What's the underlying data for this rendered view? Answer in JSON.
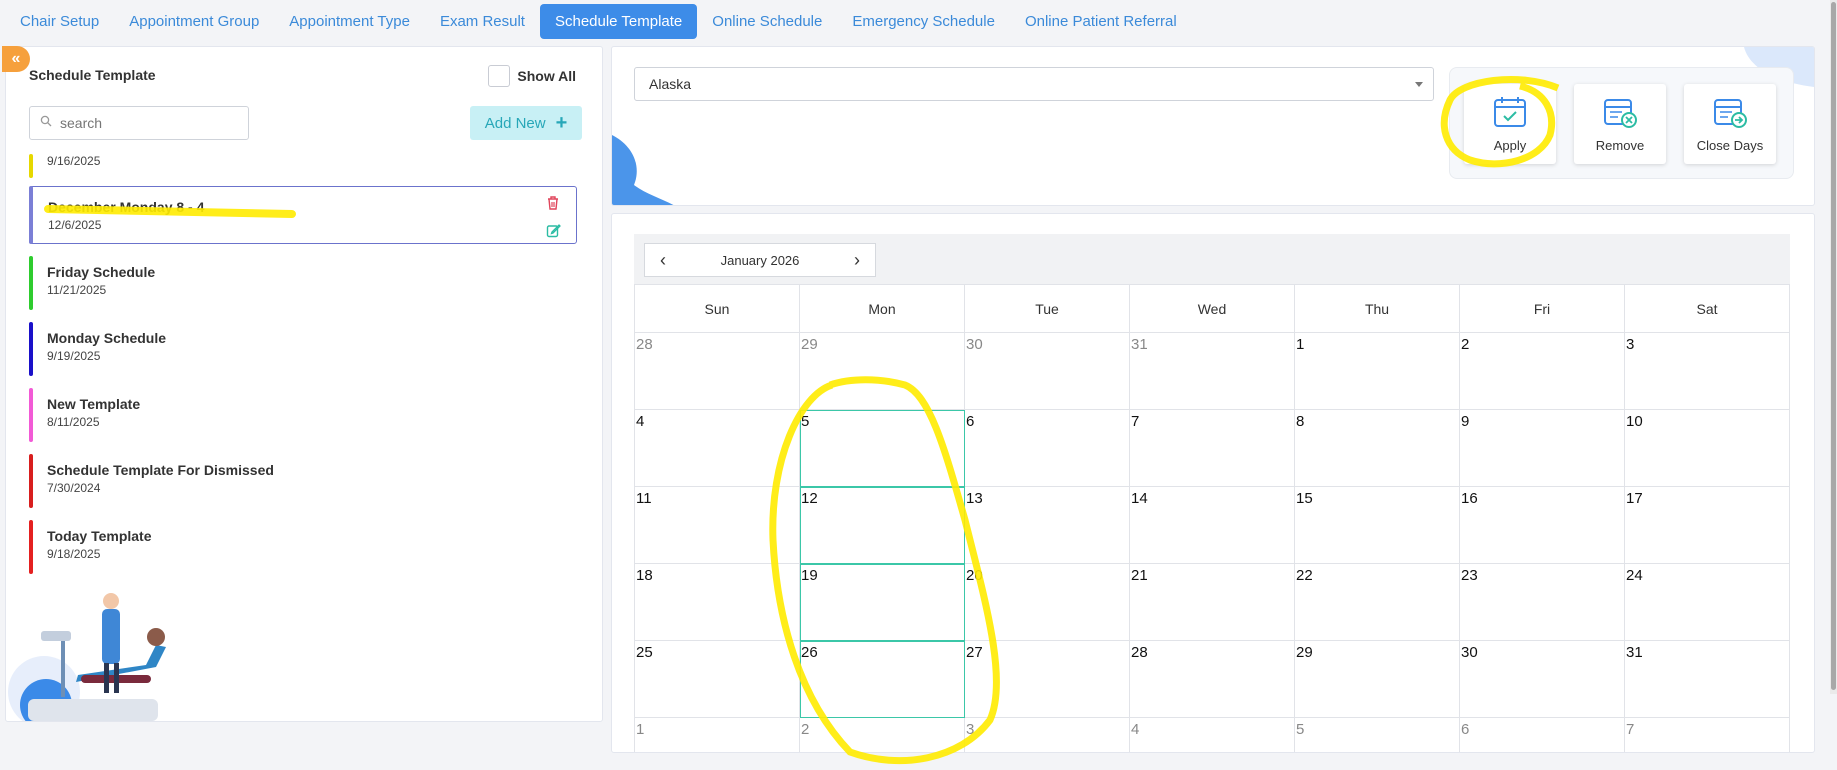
{
  "tabs": [
    {
      "label": "Chair Setup",
      "active": false
    },
    {
      "label": "Appointment Group",
      "active": false
    },
    {
      "label": "Appointment Type",
      "active": false
    },
    {
      "label": "Exam Result",
      "active": false
    },
    {
      "label": "Schedule Template",
      "active": true
    },
    {
      "label": "Online Schedule",
      "active": false
    },
    {
      "label": "Emergency Schedule",
      "active": false
    },
    {
      "label": "Online Patient Referral",
      "active": false
    }
  ],
  "left": {
    "title": "Schedule Template",
    "show_all_label": "Show All",
    "search_placeholder": "search",
    "add_new_label": "Add New",
    "templates": [
      {
        "name": "",
        "date": "9/16/2025",
        "color": "#e6d800"
      },
      {
        "name": "December Monday 8 - 4",
        "date": "12/6/2025",
        "color": "#7b7fd6",
        "selected": true
      },
      {
        "name": "Friday Schedule",
        "date": "11/21/2025",
        "color": "#2ecc2e"
      },
      {
        "name": "Monday Schedule",
        "date": "9/19/2025",
        "color": "#1a10c9"
      },
      {
        "name": "New Template",
        "date": "8/11/2025",
        "color": "#f25ad6"
      },
      {
        "name": "Schedule Template For Dismissed",
        "date": "7/30/2024",
        "color": "#d81e1e"
      },
      {
        "name": "Today Template",
        "date": "9/18/2025",
        "color": "#e42020"
      }
    ]
  },
  "right": {
    "state_value": "Alaska",
    "actions": {
      "apply_label": "Apply",
      "remove_label": "Remove",
      "close_days_label": "Close Days"
    }
  },
  "calendar": {
    "month_label": "January 2026",
    "weekdays": [
      "Sun",
      "Mon",
      "Tue",
      "Wed",
      "Thu",
      "Fri",
      "Sat"
    ],
    "weeks": [
      [
        "28",
        "29",
        "30",
        "31",
        "1",
        "2",
        "3"
      ],
      [
        "4",
        "5",
        "6",
        "7",
        "8",
        "9",
        "10"
      ],
      [
        "11",
        "12",
        "13",
        "14",
        "15",
        "16",
        "17"
      ],
      [
        "18",
        "19",
        "20",
        "21",
        "22",
        "23",
        "24"
      ],
      [
        "25",
        "26",
        "27",
        "28",
        "29",
        "30",
        "31"
      ],
      [
        "1",
        "2",
        "3",
        "4",
        "5",
        "6",
        "7"
      ]
    ],
    "other_month_weeks": [
      0,
      5
    ],
    "marked_days": [
      "5",
      "12",
      "19",
      "26"
    ]
  },
  "colors": {
    "accent": "#3d8ce8",
    "highlight": "#ffeb00",
    "marked_cell": "#3bc7a8"
  }
}
